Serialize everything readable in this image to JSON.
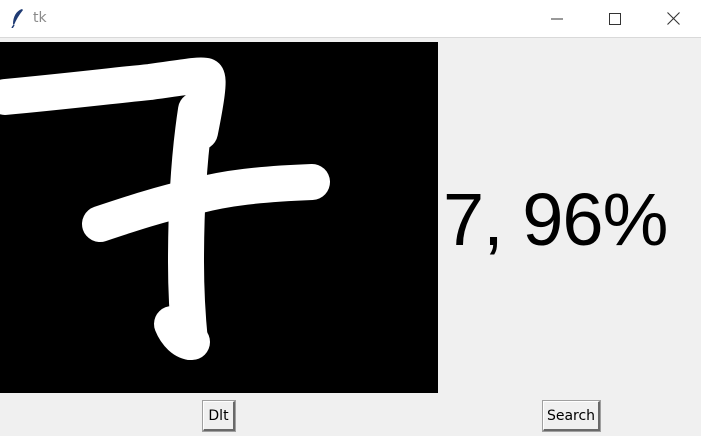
{
  "window": {
    "title": "tk",
    "icons": {
      "app": "feather-icon",
      "minimize": "minimize-icon",
      "maximize": "maximize-icon",
      "close": "close-icon"
    }
  },
  "canvas": {
    "background": "#000000",
    "stroke_color": "#ffffff",
    "drawing": "handwritten digit 7"
  },
  "result": {
    "text": "7, 96%"
  },
  "buttons": {
    "delete_label": "Dlt",
    "search_label": "Search"
  }
}
